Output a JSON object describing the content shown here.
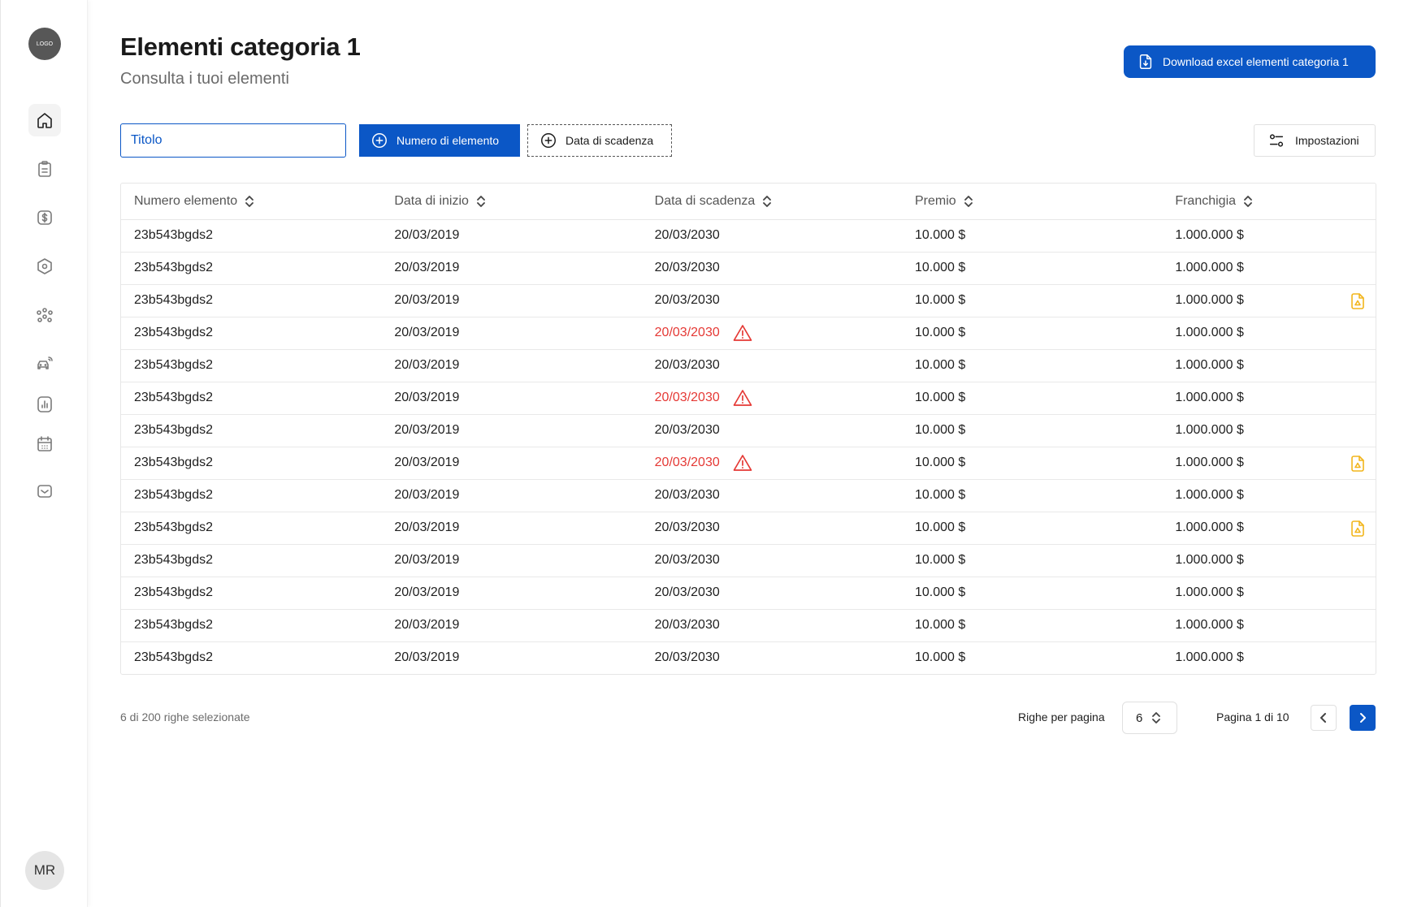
{
  "sidebar": {
    "logo_text": "LOGO",
    "items": [
      {
        "icon": "home-icon",
        "active": true
      },
      {
        "icon": "clipboard-icon",
        "active": false
      },
      {
        "icon": "dollar-icon",
        "active": false
      },
      {
        "icon": "hexagon-icon",
        "active": false
      },
      {
        "icon": "group-icon",
        "active": false
      },
      {
        "icon": "car-signal-icon",
        "active": false
      },
      {
        "icon": "bar-chart-icon",
        "active": false
      },
      {
        "icon": "calendar-icon",
        "active": false
      },
      {
        "icon": "inbox-icon",
        "active": false
      }
    ],
    "avatar_initials": "MR"
  },
  "header": {
    "title": "Elementi categoria 1",
    "subtitle": "Consulta i tuoi elementi",
    "download_label": "Download excel elementi categoria 1"
  },
  "toolbar": {
    "search_value": "Titolo",
    "filter_number_label": "Numero di elemento",
    "filter_date_label": "Data di scadenza",
    "settings_label": "Impostazioni"
  },
  "table": {
    "columns": [
      "Numero elemento",
      "Data di inizio",
      "Data di scadenza",
      "Premio",
      "Franchigia"
    ],
    "rows": [
      {
        "numero": "23b543bgds2",
        "inizio": "20/03/2019",
        "scadenza": "20/03/2030",
        "premio": "10.000 $",
        "franchigia": "1.000.000 $",
        "expired": false,
        "document": false
      },
      {
        "numero": "23b543bgds2",
        "inizio": "20/03/2019",
        "scadenza": "20/03/2030",
        "premio": "10.000 $",
        "franchigia": "1.000.000 $",
        "expired": false,
        "document": false
      },
      {
        "numero": "23b543bgds2",
        "inizio": "20/03/2019",
        "scadenza": "20/03/2030",
        "premio": "10.000 $",
        "franchigia": "1.000.000 $",
        "expired": false,
        "document": true
      },
      {
        "numero": "23b543bgds2",
        "inizio": "20/03/2019",
        "scadenza": "20/03/2030",
        "premio": "10.000 $",
        "franchigia": "1.000.000 $",
        "expired": true,
        "document": false
      },
      {
        "numero": "23b543bgds2",
        "inizio": "20/03/2019",
        "scadenza": "20/03/2030",
        "premio": "10.000 $",
        "franchigia": "1.000.000 $",
        "expired": false,
        "document": false
      },
      {
        "numero": "23b543bgds2",
        "inizio": "20/03/2019",
        "scadenza": "20/03/2030",
        "premio": "10.000 $",
        "franchigia": "1.000.000 $",
        "expired": true,
        "document": false
      },
      {
        "numero": "23b543bgds2",
        "inizio": "20/03/2019",
        "scadenza": "20/03/2030",
        "premio": "10.000 $",
        "franchigia": "1.000.000 $",
        "expired": false,
        "document": false
      },
      {
        "numero": "23b543bgds2",
        "inizio": "20/03/2019",
        "scadenza": "20/03/2030",
        "premio": "10.000 $",
        "franchigia": "1.000.000 $",
        "expired": true,
        "document": true
      },
      {
        "numero": "23b543bgds2",
        "inizio": "20/03/2019",
        "scadenza": "20/03/2030",
        "premio": "10.000 $",
        "franchigia": "1.000.000 $",
        "expired": false,
        "document": false
      },
      {
        "numero": "23b543bgds2",
        "inizio": "20/03/2019",
        "scadenza": "20/03/2030",
        "premio": "10.000 $",
        "franchigia": "1.000.000 $",
        "expired": false,
        "document": true
      },
      {
        "numero": "23b543bgds2",
        "inizio": "20/03/2019",
        "scadenza": "20/03/2030",
        "premio": "10.000 $",
        "franchigia": "1.000.000 $",
        "expired": false,
        "document": false
      },
      {
        "numero": "23b543bgds2",
        "inizio": "20/03/2019",
        "scadenza": "20/03/2030",
        "premio": "10.000 $",
        "franchigia": "1.000.000 $",
        "expired": false,
        "document": false
      },
      {
        "numero": "23b543bgds2",
        "inizio": "20/03/2019",
        "scadenza": "20/03/2030",
        "premio": "10.000 $",
        "franchigia": "1.000.000 $",
        "expired": false,
        "document": false
      },
      {
        "numero": "23b543bgds2",
        "inizio": "20/03/2019",
        "scadenza": "20/03/2030",
        "premio": "10.000 $",
        "franchigia": "1.000.000 $",
        "expired": false,
        "document": false
      }
    ]
  },
  "footer": {
    "selected_text": "6 di 200 righe selezionate",
    "rows_per_page_label": "Righe per pagina",
    "rows_per_page_value": "6",
    "page_info": "Pagina 1 di 10"
  },
  "colors": {
    "primary": "#0b57c6",
    "expired": "#e53935",
    "document": "#f2b51c"
  }
}
